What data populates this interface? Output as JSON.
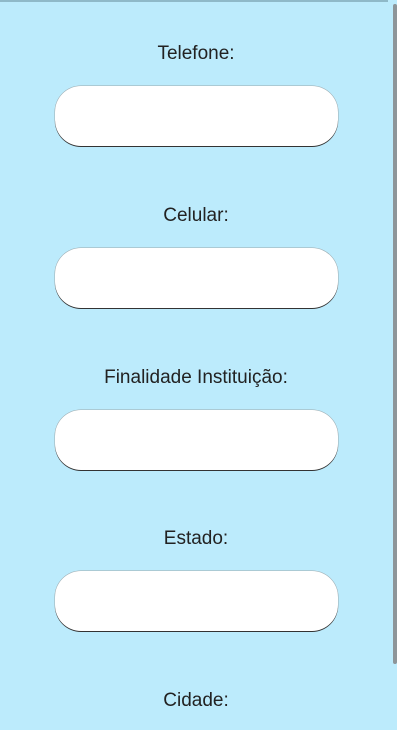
{
  "form": {
    "fields": [
      {
        "label": "Telefone:",
        "value": "",
        "placeholder": ""
      },
      {
        "label": "Celular:",
        "value": "",
        "placeholder": ""
      },
      {
        "label": "Finalidade Instituição:",
        "value": "",
        "placeholder": ""
      },
      {
        "label": "Estado:",
        "value": "",
        "placeholder": ""
      },
      {
        "label": "Cidade:"
      }
    ]
  },
  "colors": {
    "background": "#bcebfc",
    "field_background": "#ffffff",
    "label_text": "#222222",
    "scrollbar_thumb": "#8d9599"
  }
}
